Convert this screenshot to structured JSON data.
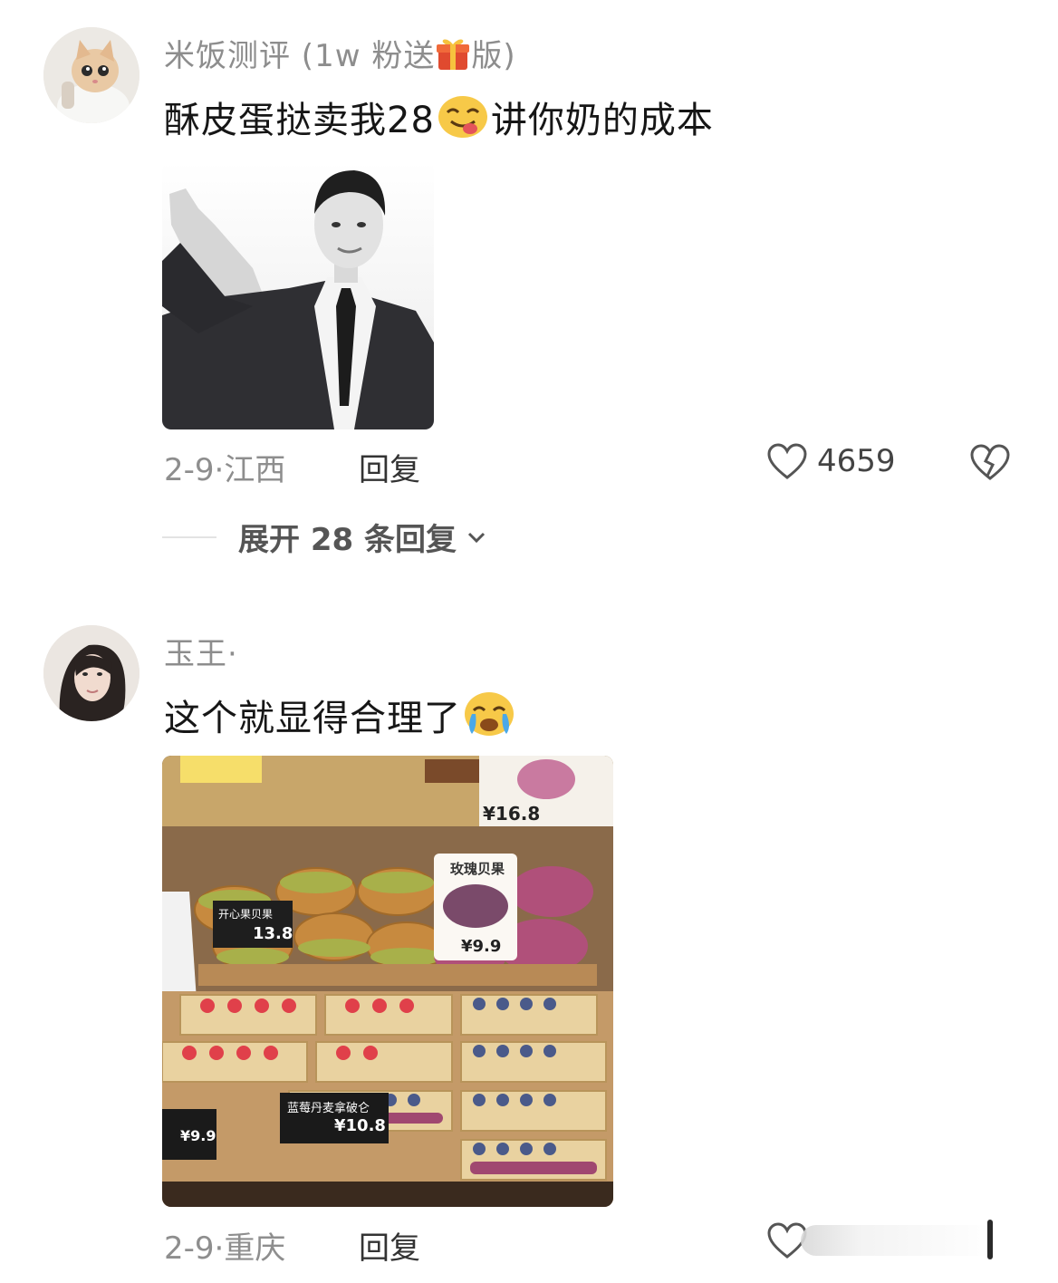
{
  "comments": [
    {
      "username": "米饭测评 (1w 粉送",
      "username_suffix": "版)",
      "text_before": "酥皮蛋挞卖我28",
      "text_after": "讲你奶的成本",
      "date_location": "2-9·江西",
      "reply_label": "回复",
      "like_count": "4659",
      "expand_label": "展开 28 条回复",
      "avatar_icon": "cat-avatar",
      "emoji_icon": "tongue-out-emoji",
      "image_icon": "man-in-suit-waving-photo"
    },
    {
      "username": "玉王·",
      "text_before": "这个就显得合理了",
      "date_location": "2-9·重庆",
      "reply_label": "回复",
      "avatar_icon": "woman-avatar",
      "emoji_icon": "crying-emoji",
      "image_icon": "bakery-display-photo",
      "photo_labels": {
        "price_top": "¥16.8",
        "rose_title": "玫瑰贝果",
        "rose_price": "¥9.9",
        "pistachio_title": "开心果贝果",
        "pistachio_price": "13.8",
        "blueberry_title": "蓝莓丹麦拿破仑",
        "blueberry_price": "¥10.8",
        "left_price": "¥9.9"
      }
    }
  ],
  "colors": {
    "username": "#8d8d8d",
    "text": "#161616",
    "meta": "#8e8e8e"
  }
}
